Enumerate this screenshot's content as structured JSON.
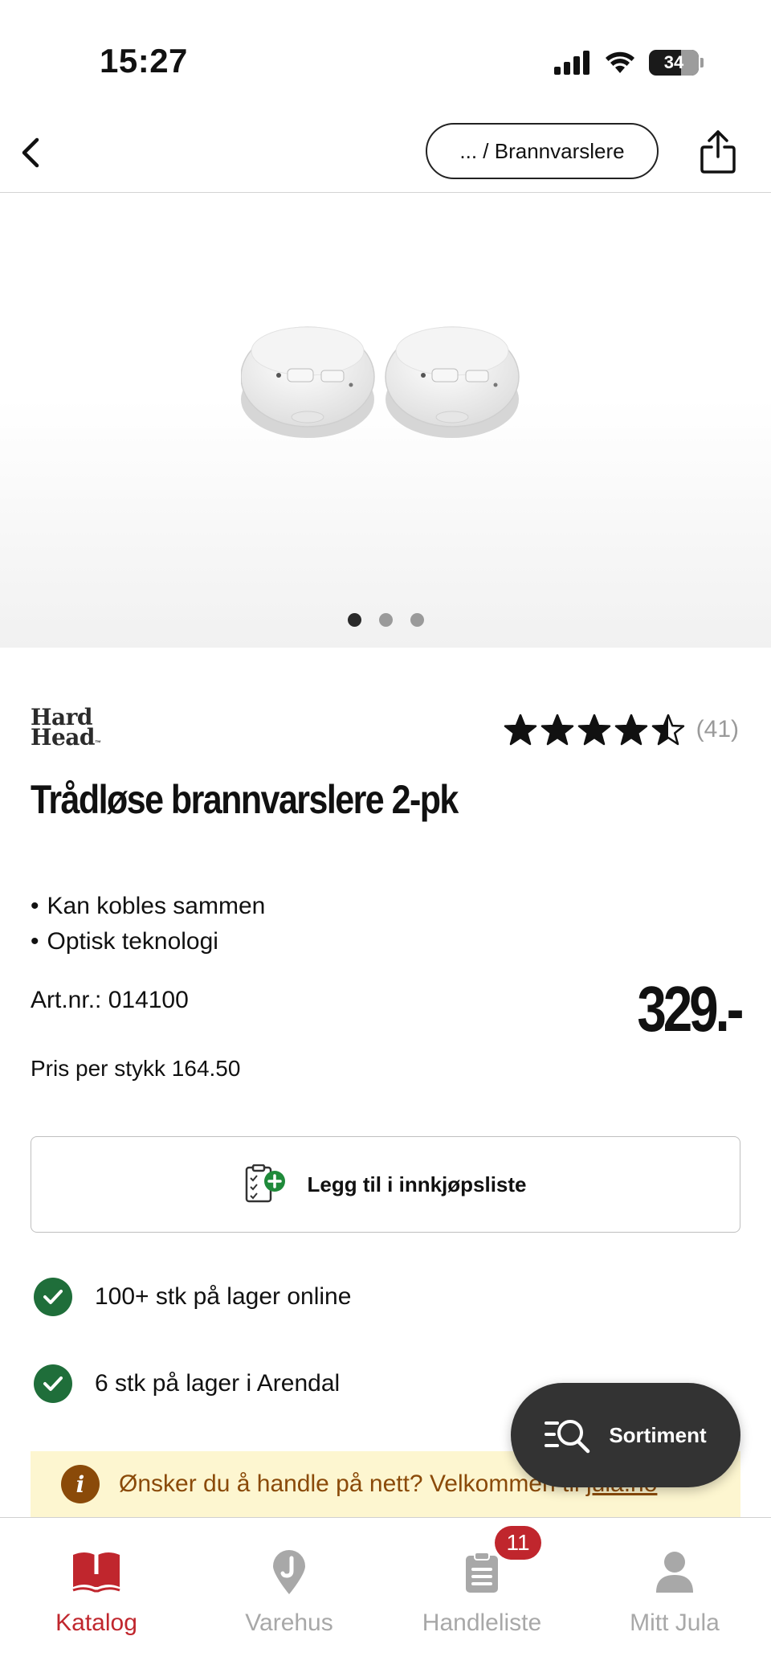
{
  "status_bar": {
    "time": "15:27",
    "battery": "34"
  },
  "nav": {
    "breadcrumb": "... / Brannvarslere"
  },
  "gallery": {
    "image_count": 3,
    "active_index": 0
  },
  "product": {
    "brand": {
      "line1": "Hard",
      "line2": "Head",
      "tm": "™"
    },
    "rating": {
      "stars": 4.5,
      "count": "(41)"
    },
    "title": "Trådløse brannvarslere 2-pk",
    "features": [
      "Kan kobles sammen",
      "Optisk teknologi"
    ],
    "artnr": "Art.nr.: 014100",
    "price": "329.-",
    "unit_price": "Pris per stykk 164.50"
  },
  "shopping_list_button": {
    "label": "Legg til i innkjøpsliste"
  },
  "stock": [
    {
      "text": "100+ stk på lager online"
    },
    {
      "text": "6 stk på lager i Arendal"
    }
  ],
  "info_banner": {
    "text": "Ønsker du å handle på nett? Velkommen til ",
    "link": "jula.no"
  },
  "fab": {
    "label": "Sortiment"
  },
  "colors": {
    "accent": "#c0262d",
    "stock_green": "#1f6e3a",
    "banner_bg": "#fdf6d0",
    "banner_text": "#8a4a09",
    "fab_bg": "#333333"
  },
  "tabbar": {
    "tabs": [
      {
        "label": "Katalog",
        "icon": "book-icon",
        "active": true
      },
      {
        "label": "Varehus",
        "icon": "map-pin-icon",
        "active": false
      },
      {
        "label": "Handleliste",
        "icon": "clipboard-icon",
        "active": false,
        "badge": "11"
      },
      {
        "label": "Mitt Jula",
        "icon": "person-icon",
        "active": false
      }
    ]
  }
}
